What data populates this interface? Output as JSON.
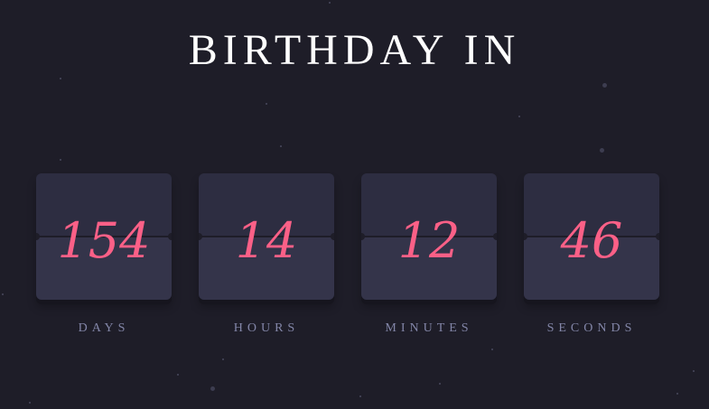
{
  "title": "BIRTHDAY IN",
  "countdown": [
    {
      "value": "154",
      "label": "DAYS"
    },
    {
      "value": "14",
      "label": "HOURS"
    },
    {
      "value": "12",
      "label": "MINUTES"
    },
    {
      "value": "46",
      "label": "SECONDS"
    }
  ],
  "colors": {
    "background": "#1e1d28",
    "card_top": "#2d2d41",
    "card_bottom": "#34344a",
    "number": "#fb6087",
    "label": "#8386a8",
    "title": "#ffffff"
  }
}
